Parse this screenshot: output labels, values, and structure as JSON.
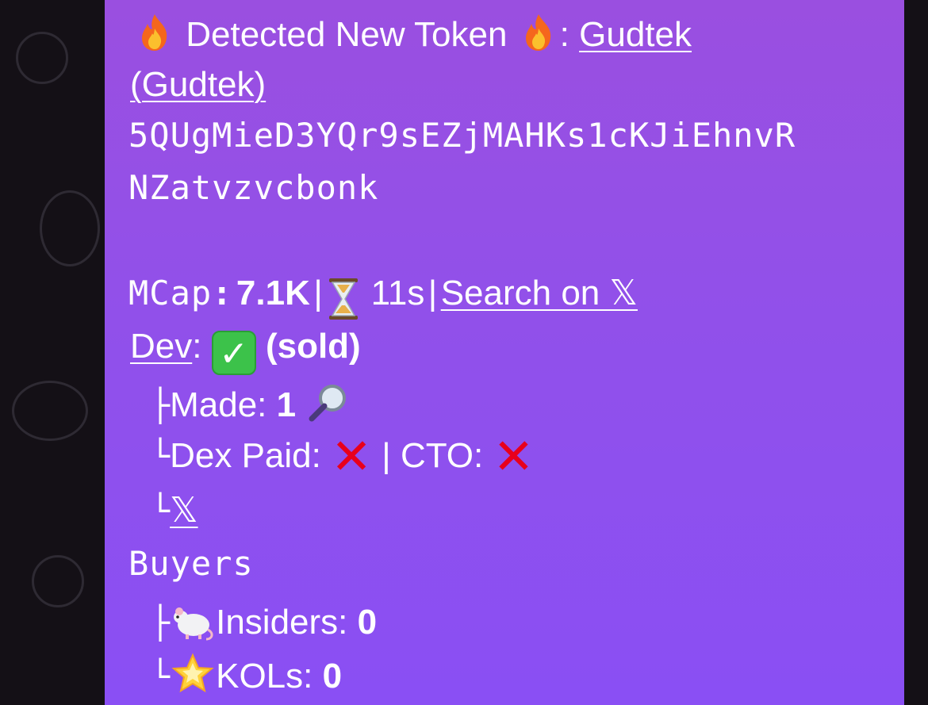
{
  "message": {
    "header_text": "Detected New Token",
    "header_sep": ":",
    "token_link_line1": "Gudtek ",
    "token_link_line2": "(Gudtek)",
    "address_line1": "5QUgMieD3YQr9sEZjMAHKs1cKJiEhnvR",
    "address_line2": "NZatvzvcbonk",
    "mcap_label": "MCap",
    "mcap_colon": ":",
    "mcap_value": "7.1K",
    "pipe": "|",
    "age": "11s",
    "search_link": "Search on 𝕏",
    "dev_link": "Dev",
    "dev_colon": ":",
    "dev_status": "(sold)",
    "made_prefix": "├",
    "made_label": "Made:",
    "made_value": "1",
    "dexpaid_prefix": "└",
    "dexpaid_label": "Dex Paid:",
    "cto_label": "CTO:",
    "x_prefix": "└",
    "x_link": "𝕏",
    "buyers_label": "Buyers",
    "insiders_prefix": "├",
    "insiders_label": "Insiders:",
    "insiders_value": "0",
    "kols_prefix": "└",
    "kols_label": "KOLs:",
    "kols_value": "0"
  },
  "icons": {
    "fire": "fire-icon",
    "hourglass": "hourglass-icon",
    "check": "check-mark-button-icon",
    "magnifier": "magnifying-glass-icon",
    "cross": "cross-mark-icon",
    "rat": "rat-icon",
    "star": "glowing-star-icon"
  },
  "colors": {
    "bubble_top": "#9a4fe0",
    "bubble_bottom": "#8a4ff4",
    "check": "#3cc24a",
    "cross": "#e8001c",
    "background": "#141016"
  }
}
